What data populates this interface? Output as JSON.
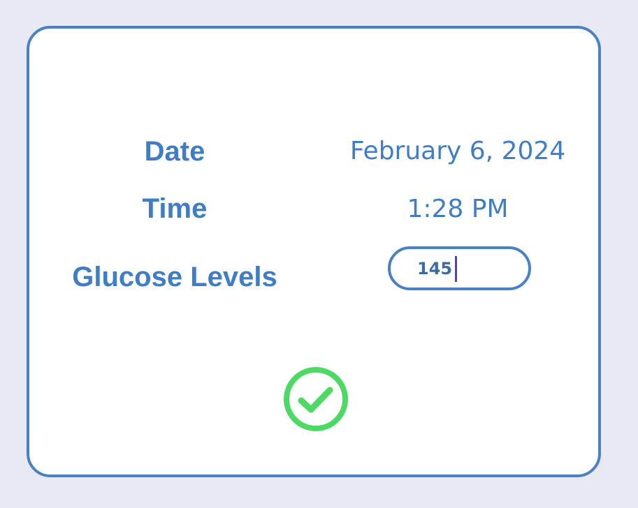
{
  "form": {
    "date_label": "Date",
    "date_value": "February 6, 2024",
    "time_label": "Time",
    "time_value": "1:28 PM",
    "glucose_label": "Glucose Levels",
    "glucose_value": "145"
  },
  "confirm": {
    "icon": "checkmark-circle-icon",
    "color": "#4cd964"
  },
  "colors": {
    "accent": "#4a80c4",
    "background": "#e8e9f4"
  }
}
